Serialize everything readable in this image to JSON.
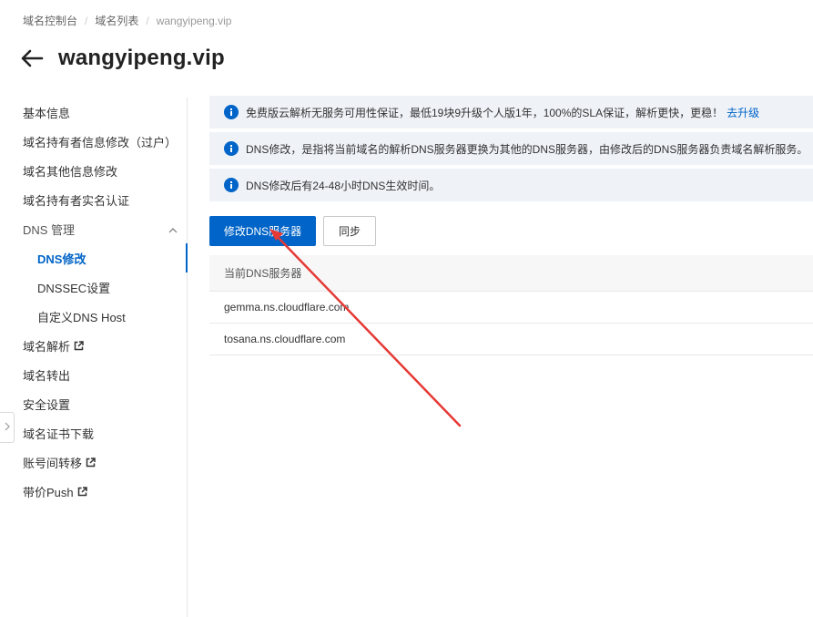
{
  "breadcrumb": [
    "域名控制台",
    "域名列表",
    "wangyipeng.vip"
  ],
  "title": "wangyipeng.vip",
  "sidebar": {
    "items": [
      {
        "label": "基本信息"
      },
      {
        "label": "域名持有者信息修改（过户）"
      },
      {
        "label": "域名其他信息修改"
      },
      {
        "label": "域名持有者实名认证"
      },
      {
        "label": "DNS 管理",
        "group": true,
        "expanded": true
      },
      {
        "label": "DNS修改",
        "sub": true,
        "active": true
      },
      {
        "label": "DNSSEC设置",
        "sub": true
      },
      {
        "label": "自定义DNS Host",
        "sub": true
      },
      {
        "label": "域名解析",
        "external": true
      },
      {
        "label": "域名转出"
      },
      {
        "label": "安全设置"
      },
      {
        "label": "域名证书下载"
      },
      {
        "label": "账号间转移",
        "external": true
      },
      {
        "label": "带价Push",
        "external": true
      }
    ]
  },
  "alerts": {
    "a1": {
      "text": "免费版云解析无服务可用性保证，最低19块9升级个人版1年，100%的SLA保证，解析更快，更稳！",
      "link": "去升级"
    },
    "a2": {
      "text": "DNS修改，是指将当前域名的解析DNS服务器更换为其他的DNS服务器，由修改后的DNS服务器负责域名解析服务。"
    },
    "a3": {
      "text": "DNS修改后有24-48小时DNS生效时间。"
    }
  },
  "buttons": {
    "modify_dns": "修改DNS服务器",
    "sync": "同步"
  },
  "table": {
    "header": "当前DNS服务器",
    "rows": [
      "gemma.ns.cloudflare.com",
      "tosana.ns.cloudflare.com"
    ]
  },
  "colors": {
    "accent": "#0064c8",
    "alert_bg": "#eff3f8",
    "annotation_arrow": "#e53935"
  },
  "icons": [
    "back-arrow-icon",
    "info-icon",
    "external-link-icon",
    "chevron-up-icon",
    "chevron-right-icon"
  ]
}
